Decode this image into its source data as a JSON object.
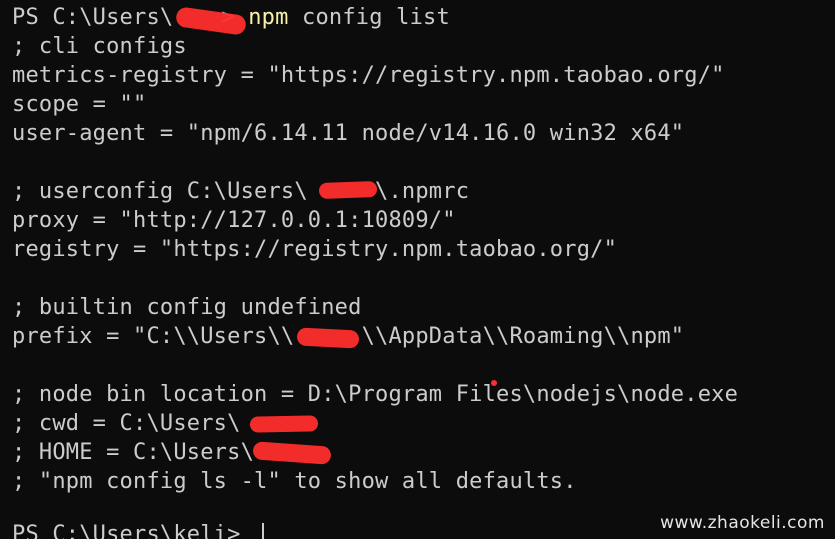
{
  "terminal": {
    "prompt_1": "PS C:\\Users\\",
    "prompt_1_suffix": "> ",
    "command_npm": "npm",
    "command_rest": " config list",
    "lines": [
      "; cli configs",
      "metrics-registry = \"https://registry.npm.taobao.org/\"",
      "scope = \"\"",
      "user-agent = \"npm/6.14.11 node/v14.16.0 win32 x64\"",
      "",
      "; userconfig C:\\Users\\     \\.npmrc",
      "proxy = \"http://127.0.0.1:10809/\"",
      "registry = \"https://registry.npm.taobao.org/\"",
      "",
      "; builtin config undefined",
      "prefix = \"C:\\\\Users\\\\     \\\\AppData\\\\Roaming\\\\npm\"",
      "",
      "; node bin location = D:\\Program Files\\nodejs\\node.exe",
      "; cwd = C:\\Users\\",
      "; HOME = C:\\Users\\",
      "; \"npm config ls -l\" to show all defaults."
    ],
    "prompt_2": "PS C:\\Users\\keli> "
  },
  "watermark": "www.zhaokeli.com",
  "colors": {
    "background": "#0c0c0c",
    "text": "#cccccc",
    "command_highlight": "#f9f1a5",
    "redaction": "#ff2d2d"
  }
}
